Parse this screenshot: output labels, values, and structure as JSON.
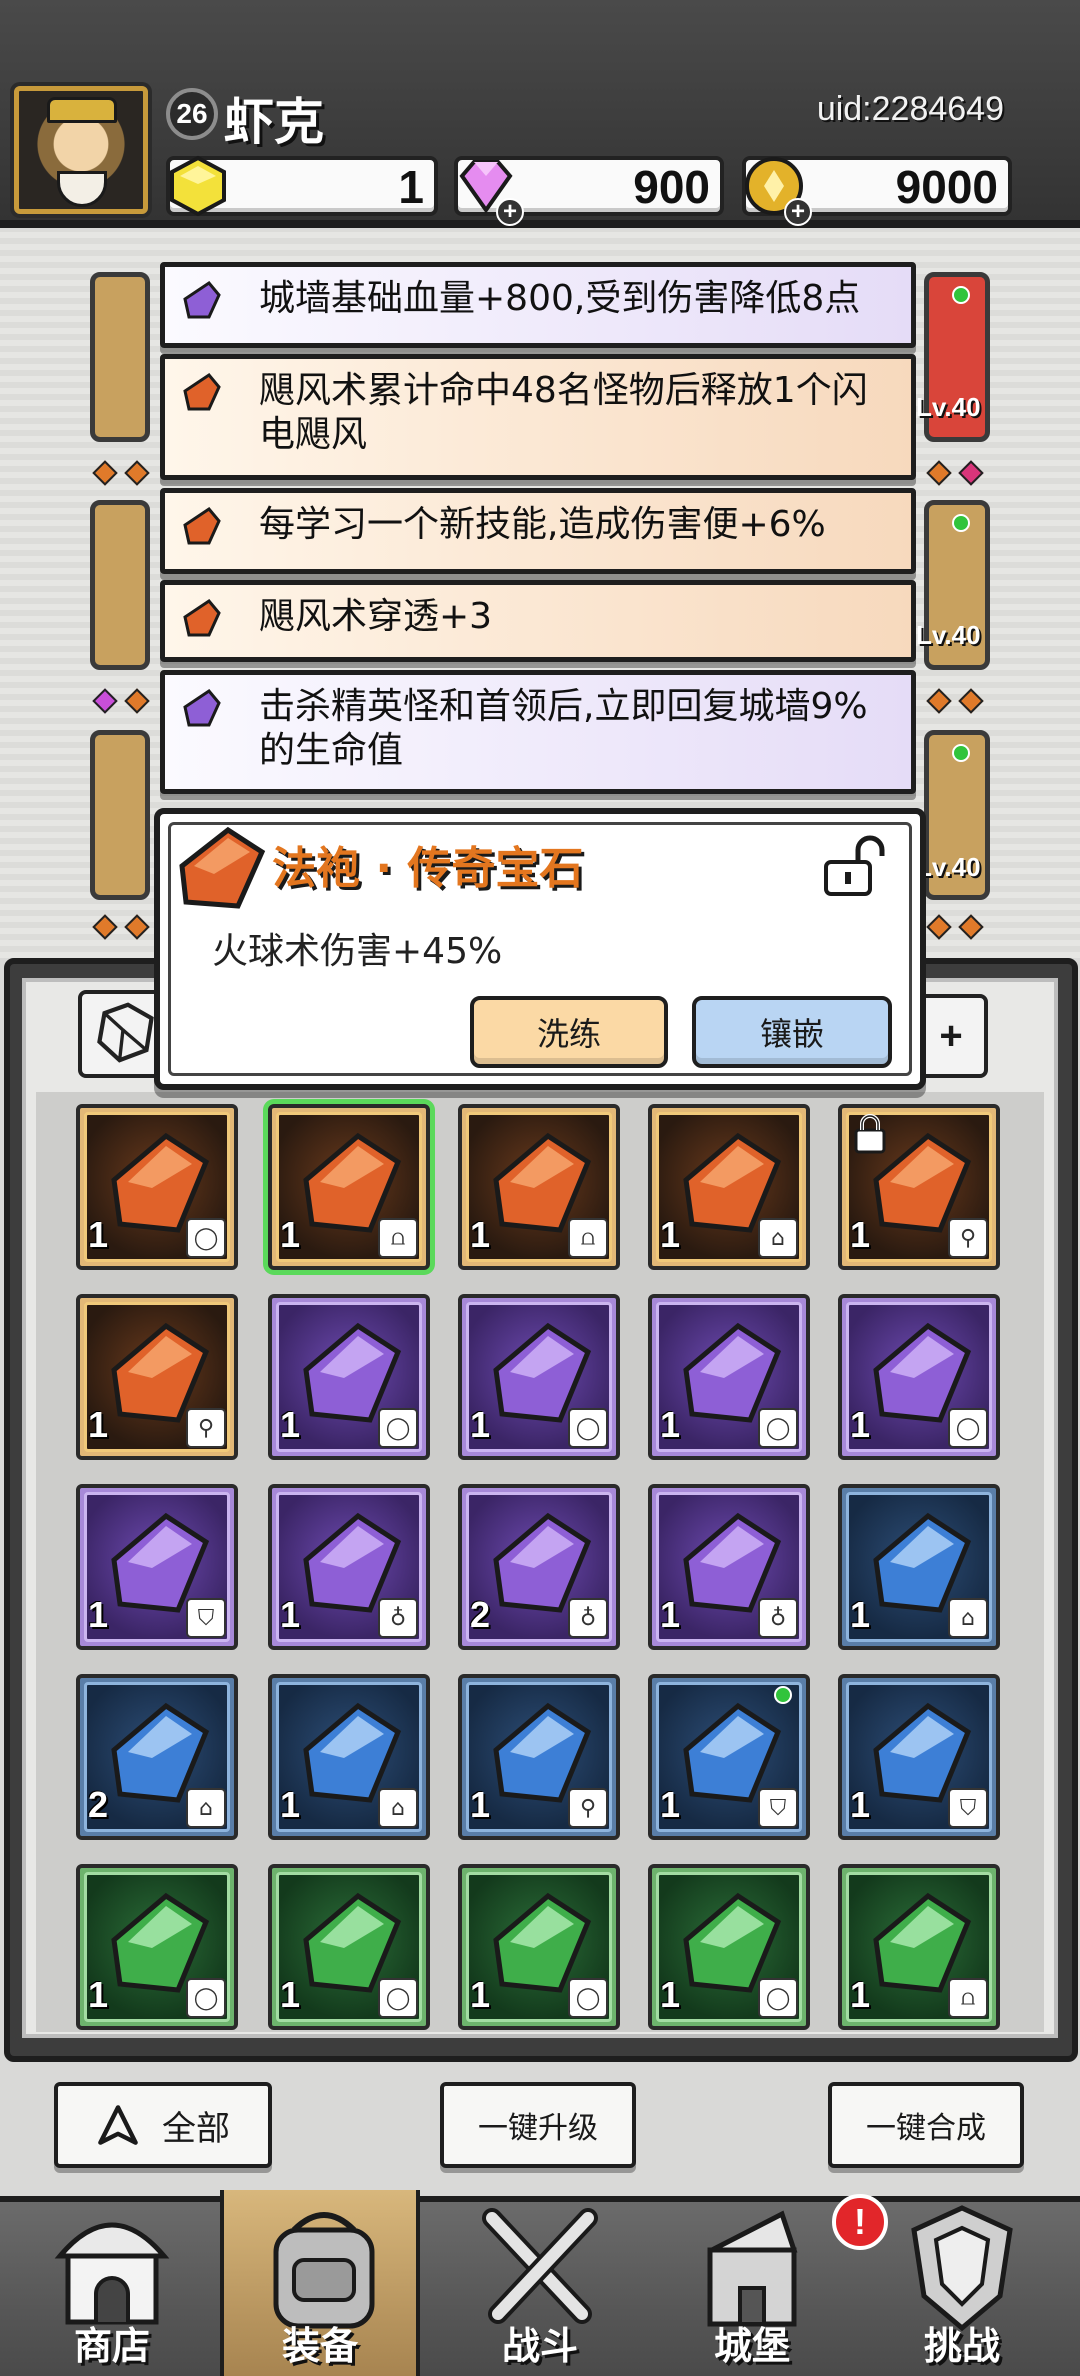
{
  "header": {
    "level": "26",
    "name": "虾克",
    "uid": "uid:2284649",
    "resources": [
      {
        "name": "gold-stone",
        "value": "1",
        "icon": "yellow-gem-icon"
      },
      {
        "name": "diamond",
        "value": "900",
        "icon": "pink-diamond-icon"
      },
      {
        "name": "coin",
        "value": "9000",
        "icon": "gold-coin-icon"
      }
    ]
  },
  "background_equip": {
    "levels": [
      "Lv.40",
      "Lv.40",
      "Lv.40"
    ]
  },
  "affixes": [
    {
      "rarity": "purple",
      "text": "城墙基础血量+800,受到伤害降低8点"
    },
    {
      "rarity": "orange",
      "text": "飓风术累计命中48名怪物后释放1个闪电飓风"
    },
    {
      "rarity": "orange",
      "text": "每学习一个新技能,造成伤害便+6%"
    },
    {
      "rarity": "orange",
      "text": "飓风术穿透+3"
    },
    {
      "rarity": "purple",
      "text": "击杀精英怪和首领后,立即回复城墙9%的生命值"
    }
  ],
  "detail": {
    "title": "法袍 · 传奇宝石",
    "description": "火球术伤害+45%",
    "refine_label": "洗练",
    "inlay_label": "镶嵌"
  },
  "inventory": {
    "plus_label": "+",
    "cells": [
      {
        "color": "orange",
        "count": "1",
        "slot": "ring-icon"
      },
      {
        "color": "orange",
        "count": "1",
        "slot": "robe-icon",
        "selected": true
      },
      {
        "color": "orange",
        "count": "1",
        "slot": "robe-icon"
      },
      {
        "color": "orange",
        "count": "1",
        "slot": "boots-icon"
      },
      {
        "color": "orange",
        "count": "1",
        "slot": "staff-icon",
        "locked": true
      },
      {
        "color": "orange",
        "count": "1",
        "slot": "staff-icon"
      },
      {
        "color": "purple",
        "count": "1",
        "slot": "ring-icon"
      },
      {
        "color": "purple",
        "count": "1",
        "slot": "ring-icon"
      },
      {
        "color": "purple",
        "count": "1",
        "slot": "ring-icon"
      },
      {
        "color": "purple",
        "count": "1",
        "slot": "ring-icon"
      },
      {
        "color": "purple",
        "count": "1",
        "slot": "hat-icon"
      },
      {
        "color": "purple",
        "count": "1",
        "slot": "amulet-icon"
      },
      {
        "color": "purple",
        "count": "2",
        "slot": "amulet-icon"
      },
      {
        "color": "purple",
        "count": "1",
        "slot": "amulet-icon"
      },
      {
        "color": "blue",
        "count": "1",
        "slot": "boots-icon"
      },
      {
        "color": "blue",
        "count": "2",
        "slot": "boots-icon"
      },
      {
        "color": "blue",
        "count": "1",
        "slot": "boots-icon"
      },
      {
        "color": "blue",
        "count": "1",
        "slot": "staff-icon"
      },
      {
        "color": "blue",
        "count": "1",
        "slot": "hat-icon",
        "dot": true
      },
      {
        "color": "blue",
        "count": "1",
        "slot": "hat-icon"
      },
      {
        "color": "green",
        "count": "1",
        "slot": "ring-icon"
      },
      {
        "color": "green",
        "count": "1",
        "slot": "ring-icon"
      },
      {
        "color": "green",
        "count": "1",
        "slot": "ring-icon"
      },
      {
        "color": "green",
        "count": "1",
        "slot": "ring-icon"
      },
      {
        "color": "green",
        "count": "1",
        "slot": "robe-icon"
      }
    ]
  },
  "actions": {
    "filter_all": "全部",
    "upgrade_all": "一键升级",
    "merge_all": "一键合成"
  },
  "nav": [
    {
      "label": "商店",
      "icon": "shop-icon"
    },
    {
      "label": "装备",
      "icon": "backpack-icon",
      "active": true
    },
    {
      "label": "战斗",
      "icon": "crossed-swords-icon"
    },
    {
      "label": "城堡",
      "icon": "castle-icon",
      "alert": "!"
    },
    {
      "label": "挑战",
      "icon": "shield-crest-icon"
    }
  ],
  "colors": {
    "orange_gem": "#e0622a",
    "purple_gem": "#8e5fd6",
    "blue_gem": "#3d7fd6",
    "green_gem": "#3fae4a",
    "title_orange": "#e3761f"
  }
}
